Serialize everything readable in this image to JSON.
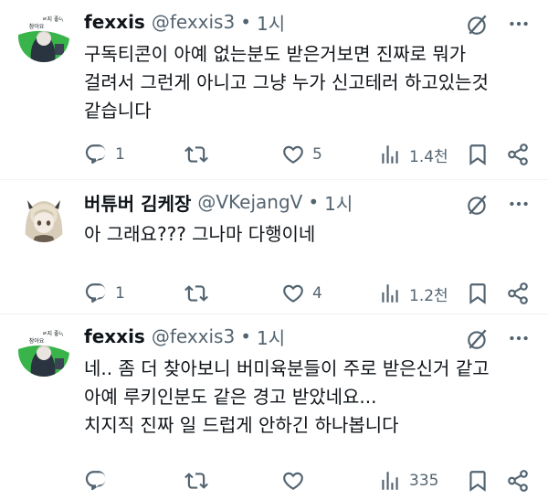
{
  "tweets": [
    {
      "name": "fexxis",
      "handle": "@fexxis3",
      "dot": "•",
      "time": "1시",
      "avatar_text": [
        "ㄹ지 좋아",
        "참아요"
      ],
      "text_lines": [
        "구독티콘이 아예 없는분도 받은거보면 진짜로 뭐가",
        "걸려서 그런게 아니고 그냥 누가 신고테러 하고있는것",
        "같습니다"
      ],
      "replies": "1",
      "retweets": "",
      "likes": "5",
      "views": "1.4천"
    },
    {
      "name": "버튜버 김케장",
      "handle": "@VKejangV",
      "dot": "•",
      "time": "1시",
      "text_lines": [
        "아 그래요??? 그나마 다행이네"
      ],
      "replies": "1",
      "retweets": "",
      "likes": "4",
      "views": "1.2천"
    },
    {
      "name": "fexxis",
      "handle": "@fexxis3",
      "dot": "•",
      "time": "1시",
      "avatar_text": [
        "ㄹ지 좋아",
        "참아요"
      ],
      "text_lines": [
        "네.. 좀 더 찾아보니 버미육분들이 주로 받은신거 같고",
        "아예 루키인분도 같은 경고 받았네요...",
        "치지직 진짜 일 드럽게 안하긴 하나봅니다"
      ],
      "replies": "",
      "retweets": "",
      "likes": "",
      "views": "335"
    }
  ],
  "colors": {
    "text": "#0f1419",
    "secondary": "#536471",
    "divider": "#eff3f4",
    "avatar_green": "#39b44a"
  },
  "icons": [
    "reply-icon",
    "retweet-icon",
    "like-icon",
    "views-icon",
    "bookmark-icon",
    "share-icon",
    "grok-icon",
    "more-icon"
  ]
}
